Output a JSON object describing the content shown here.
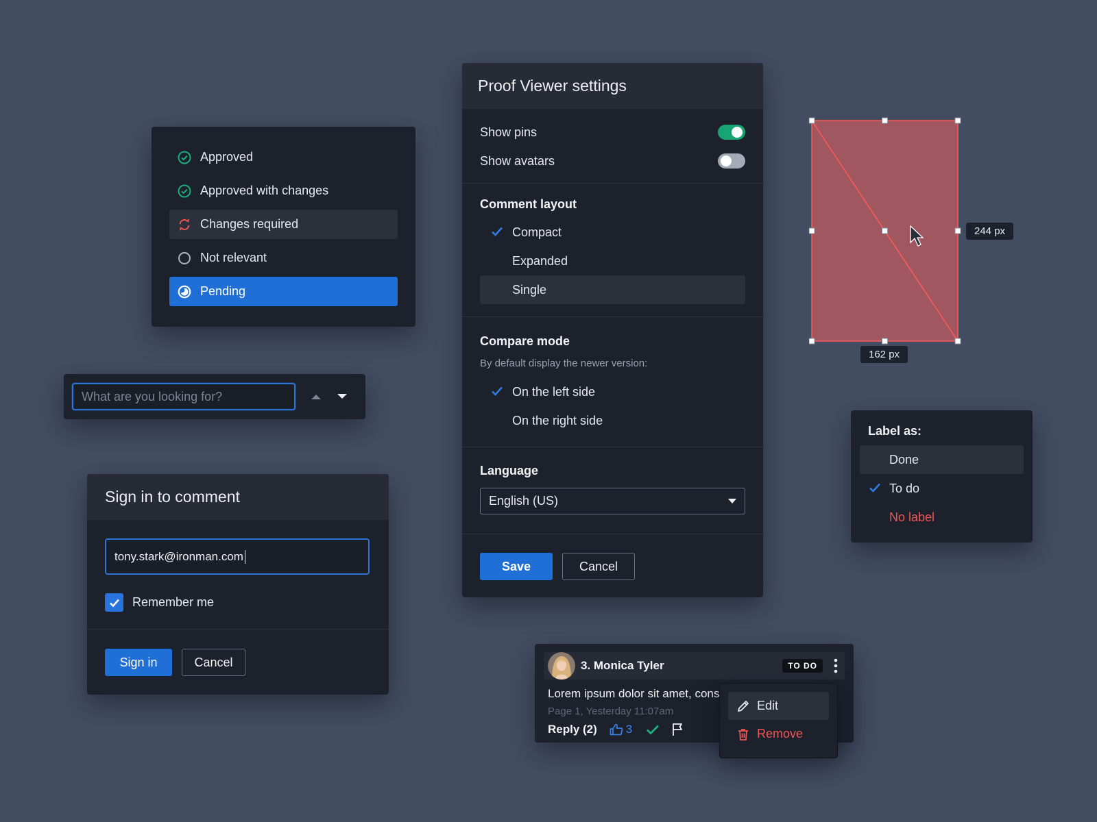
{
  "status_menu": {
    "items": [
      {
        "label": "Approved",
        "icon": "check-circle-icon"
      },
      {
        "label": "Approved with changes",
        "icon": "check-circle-icon"
      },
      {
        "label": "Changes required",
        "icon": "refresh-icon"
      },
      {
        "label": "Not relevant",
        "icon": "empty-circle-icon"
      },
      {
        "label": "Pending",
        "icon": "half-circle-icon"
      }
    ],
    "selected": "Pending",
    "hovered": "Changes required"
  },
  "search": {
    "placeholder": "What are you looking for?",
    "value": ""
  },
  "signin": {
    "title": "Sign in to comment",
    "email_value": "tony.stark@ironman.com",
    "remember_label": "Remember me",
    "remember_checked": true,
    "signin_label": "Sign in",
    "cancel_label": "Cancel"
  },
  "settings": {
    "title": "Proof Viewer settings",
    "show_pins_label": "Show pins",
    "show_pins": true,
    "show_avatars_label": "Show avatars",
    "show_avatars": false,
    "comment_layout_title": "Comment layout",
    "comment_layout_options": [
      "Compact",
      "Expanded",
      "Single"
    ],
    "comment_layout_selected": "Compact",
    "compare_mode_title": "Compare mode",
    "compare_mode_helper": "By default display the newer version:",
    "compare_options": [
      "On the left side",
      "On the right side"
    ],
    "compare_selected": "On the left side",
    "language_title": "Language",
    "language_value": "English (US)",
    "save_label": "Save",
    "cancel_label": "Cancel"
  },
  "shape": {
    "height_label": "244 px",
    "width_label": "162 px"
  },
  "label_menu": {
    "title": "Label as:",
    "options": [
      "Done",
      "To do",
      "No label"
    ],
    "selected": "To do"
  },
  "comment": {
    "author": "3. Monica Tyler",
    "badge": "TO DO",
    "text": "Lorem ipsum dolor sit amet, cons",
    "meta": "Page 1, Yesterday 11:07am",
    "reply_label": "Reply (2)",
    "likes": "3"
  },
  "context_menu": {
    "edit_label": "Edit",
    "remove_label": "Remove"
  },
  "colors": {
    "background": "#434d62",
    "panel": "#1d212b",
    "accent_blue": "#1f6fd6",
    "success_green": "#17a673",
    "danger_red": "#ee5656"
  }
}
